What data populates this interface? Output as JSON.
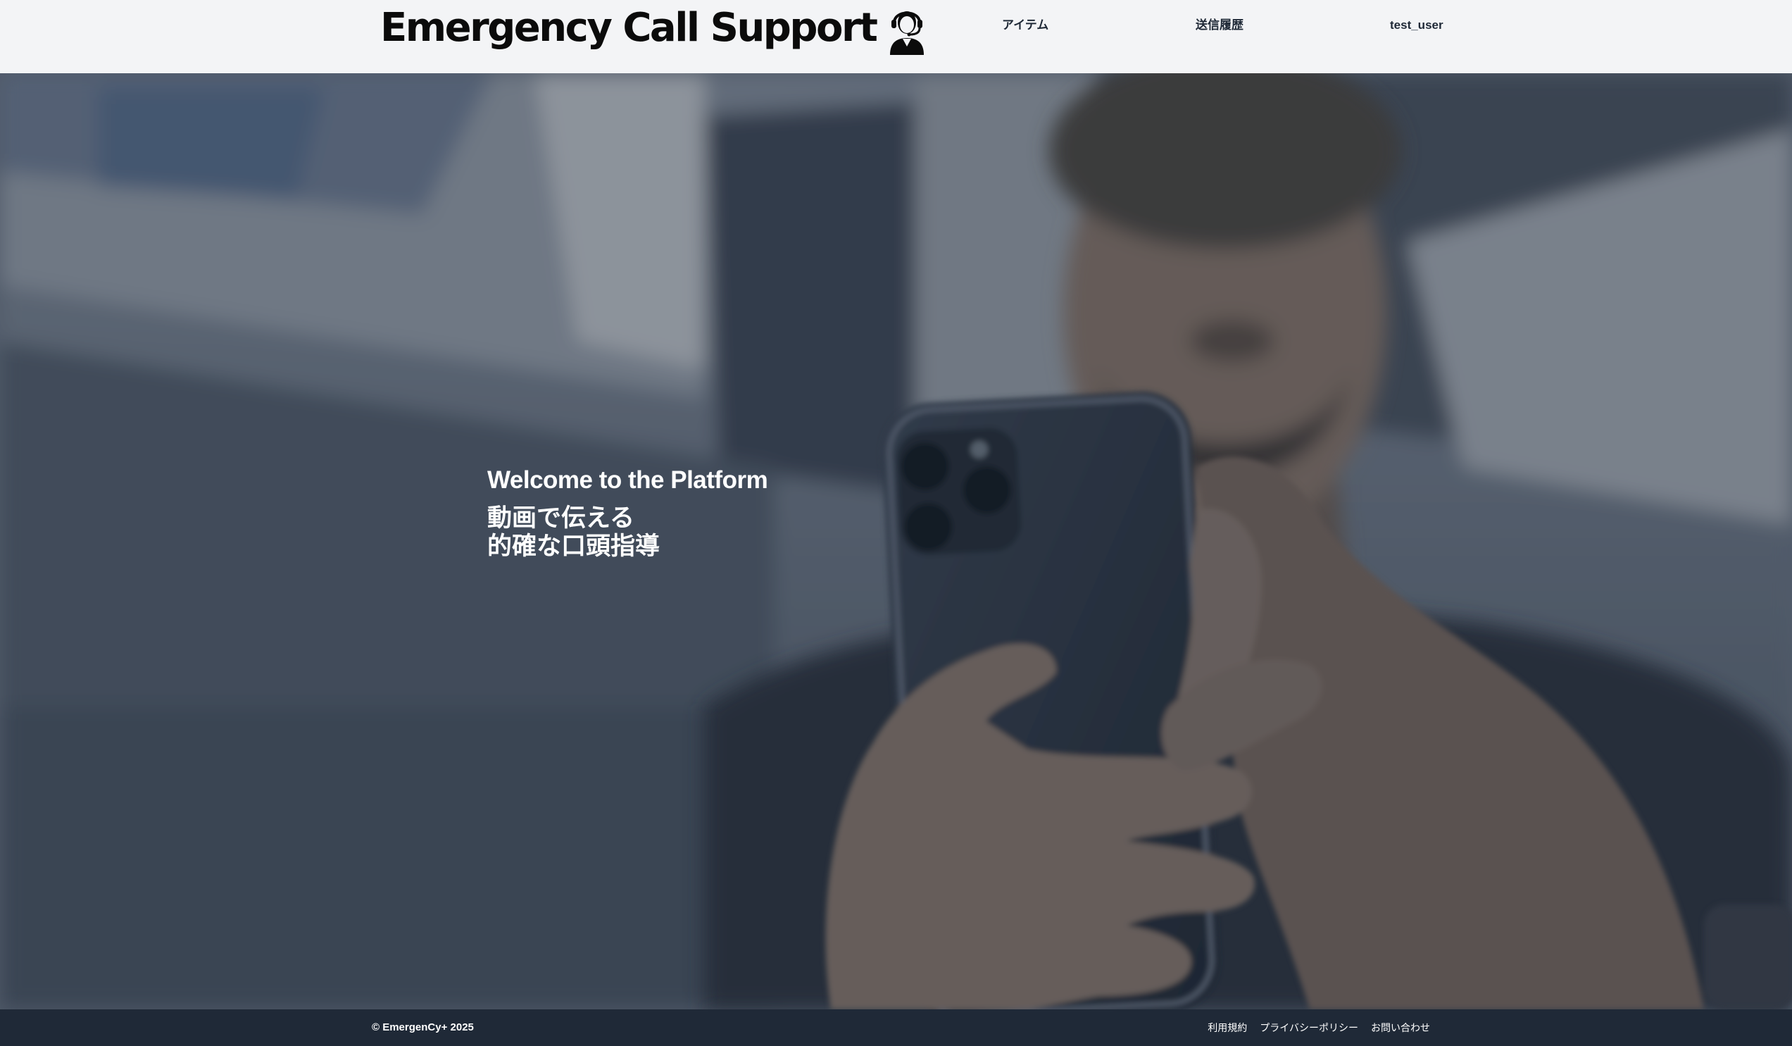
{
  "header": {
    "brand": "Emergency Call Support",
    "brand_icon": "operator-headset-icon",
    "nav": {
      "items": "アイテム",
      "history": "送信履歴",
      "user": "test_user"
    }
  },
  "hero": {
    "title": "Welcome to the Platform",
    "subtitle_line1": "動画で伝える",
    "subtitle_line2": "的確な口頭指導",
    "background_image": "person-holding-smartphone-photo"
  },
  "footer": {
    "copyright": "© EmergenCy+ 2025",
    "links": [
      "利用規約",
      "プライバシーポリシー",
      "お問い合わせ"
    ]
  },
  "colors": {
    "header_bg": "#f3f4f6",
    "footer_bg": "#1f2937",
    "hero_overlay": "#1f2937",
    "text_on_dark": "#ffffff"
  }
}
